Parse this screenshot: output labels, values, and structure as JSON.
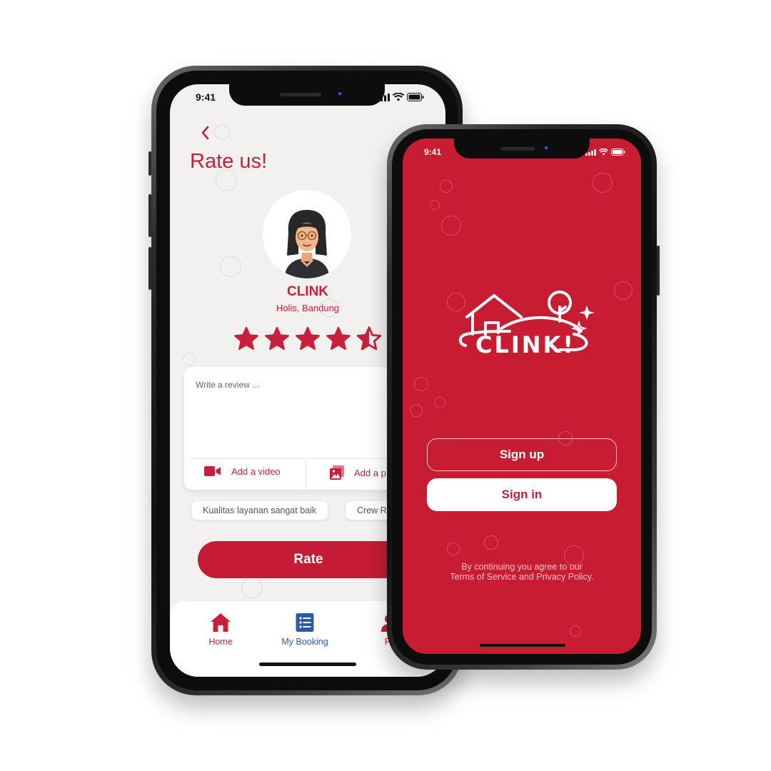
{
  "colors": {
    "brand_red": "#c81c33",
    "blue_accent": "#2b5aa8",
    "bg_light": "#f3f0f0"
  },
  "left_phone": {
    "status": {
      "time": "9:41"
    },
    "back_icon": "chevron-left-icon",
    "title": "Rate us!",
    "business": {
      "name": "CLINK",
      "location": "Holis, Bandung"
    },
    "rating": {
      "value": 4.5,
      "max": 5
    },
    "review": {
      "placeholder": "Write a review ...",
      "add_video": "Add a video",
      "add_photo": "Add a p"
    },
    "chips": [
      "Kualitas layanan sangat baik",
      "Crew R"
    ],
    "rate_button": "Rate",
    "tabs": [
      {
        "label": "Home",
        "icon": "home-icon",
        "color": "#c81c33"
      },
      {
        "label": "My Booking",
        "icon": "list-icon",
        "color": "#2b5aa8"
      },
      {
        "label": "Pr",
        "icon": "profile-icon",
        "color": "#c81c33"
      }
    ]
  },
  "right_phone": {
    "status": {
      "time": "9:41"
    },
    "logo_text": "CLINK!",
    "sign_up": "Sign up",
    "sign_in": "Sign in",
    "legal_line1": "By continuing you agree to our",
    "legal_line2": "Terms of Service and Privacy Policy."
  }
}
